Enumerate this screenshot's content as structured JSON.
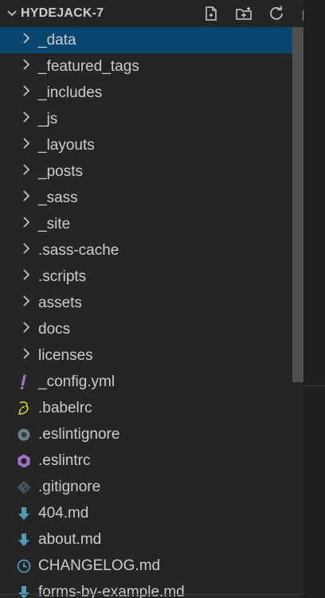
{
  "explorer": {
    "title": "HYDEJACK-7",
    "actions": [
      {
        "name": "new-file-icon"
      },
      {
        "name": "new-folder-icon"
      },
      {
        "name": "refresh-icon"
      },
      {
        "name": "collapse-all-icon"
      }
    ]
  },
  "items": [
    {
      "label": "_data",
      "type": "folder",
      "icon": "chevron-right-icon"
    },
    {
      "label": "_featured_tags",
      "type": "folder",
      "icon": "chevron-right-icon"
    },
    {
      "label": "_includes",
      "type": "folder",
      "icon": "chevron-right-icon"
    },
    {
      "label": "_js",
      "type": "folder",
      "icon": "chevron-right-icon"
    },
    {
      "label": "_layouts",
      "type": "folder",
      "icon": "chevron-right-icon"
    },
    {
      "label": "_posts",
      "type": "folder",
      "icon": "chevron-right-icon"
    },
    {
      "label": "_sass",
      "type": "folder",
      "icon": "chevron-right-icon"
    },
    {
      "label": "_site",
      "type": "folder",
      "icon": "chevron-right-icon"
    },
    {
      "label": ".sass-cache",
      "type": "folder",
      "icon": "chevron-right-icon"
    },
    {
      "label": ".scripts",
      "type": "folder",
      "icon": "chevron-right-icon"
    },
    {
      "label": "assets",
      "type": "folder",
      "icon": "chevron-right-icon"
    },
    {
      "label": "docs",
      "type": "folder",
      "icon": "chevron-right-icon"
    },
    {
      "label": "licenses",
      "type": "folder",
      "icon": "chevron-right-icon"
    },
    {
      "label": "_config.yml",
      "type": "file",
      "icon": "yaml-exclamation-icon",
      "icon_color": "#a074c4"
    },
    {
      "label": ".babelrc",
      "type": "file",
      "icon": "babel-icon",
      "icon_color": "#cbcb41"
    },
    {
      "label": ".eslintignore",
      "type": "file",
      "icon": "eslint-ignore-icon",
      "icon_color": "#6d8086"
    },
    {
      "label": ".eslintrc",
      "type": "file",
      "icon": "eslint-icon",
      "icon_color": "#a074c4"
    },
    {
      "label": ".gitignore",
      "type": "file",
      "icon": "git-icon",
      "icon_color": "#41535b"
    },
    {
      "label": "404.md",
      "type": "file",
      "icon": "markdown-icon",
      "icon_color": "#519aba"
    },
    {
      "label": "about.md",
      "type": "file",
      "icon": "markdown-icon",
      "icon_color": "#519aba"
    },
    {
      "label": "CHANGELOG.md",
      "type": "file",
      "icon": "changelog-clock-icon",
      "icon_color": "#519aba"
    },
    {
      "label": "forms-by-example.md",
      "type": "file",
      "icon": "markdown-icon",
      "icon_color": "#519aba"
    }
  ],
  "selected_index": 0,
  "colors": {
    "background": "#252526",
    "selection": "#094771",
    "text": "#cccccc",
    "scrollbar_thumb": "#4f4f4f"
  }
}
